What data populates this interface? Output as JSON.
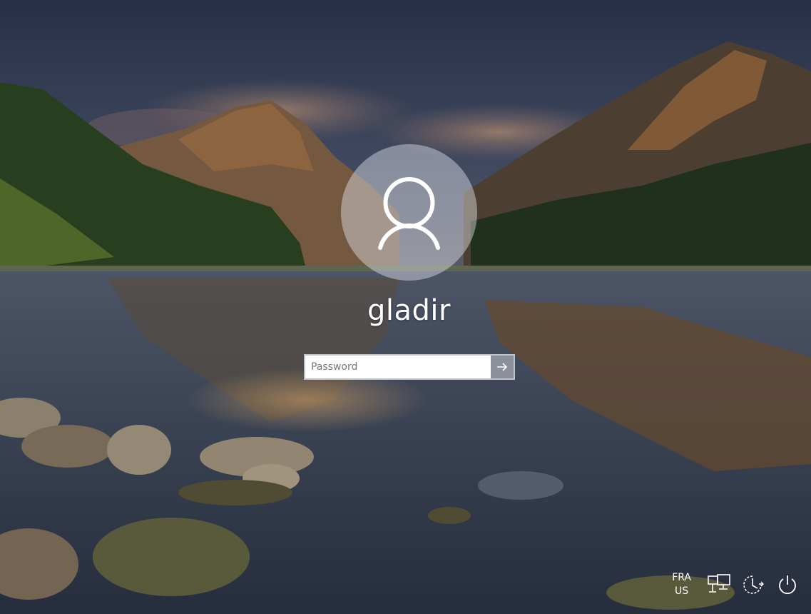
{
  "login": {
    "username": "gladir",
    "password_placeholder": "Password"
  },
  "tray": {
    "language_primary": "FRA",
    "language_secondary": "US",
    "icons": [
      "network-icon",
      "ease-of-access-icon",
      "power-icon"
    ]
  },
  "colors": {
    "text": "#ffffff",
    "avatar_circle": "#e9ecf2",
    "submit_button": "#8a8f99"
  }
}
